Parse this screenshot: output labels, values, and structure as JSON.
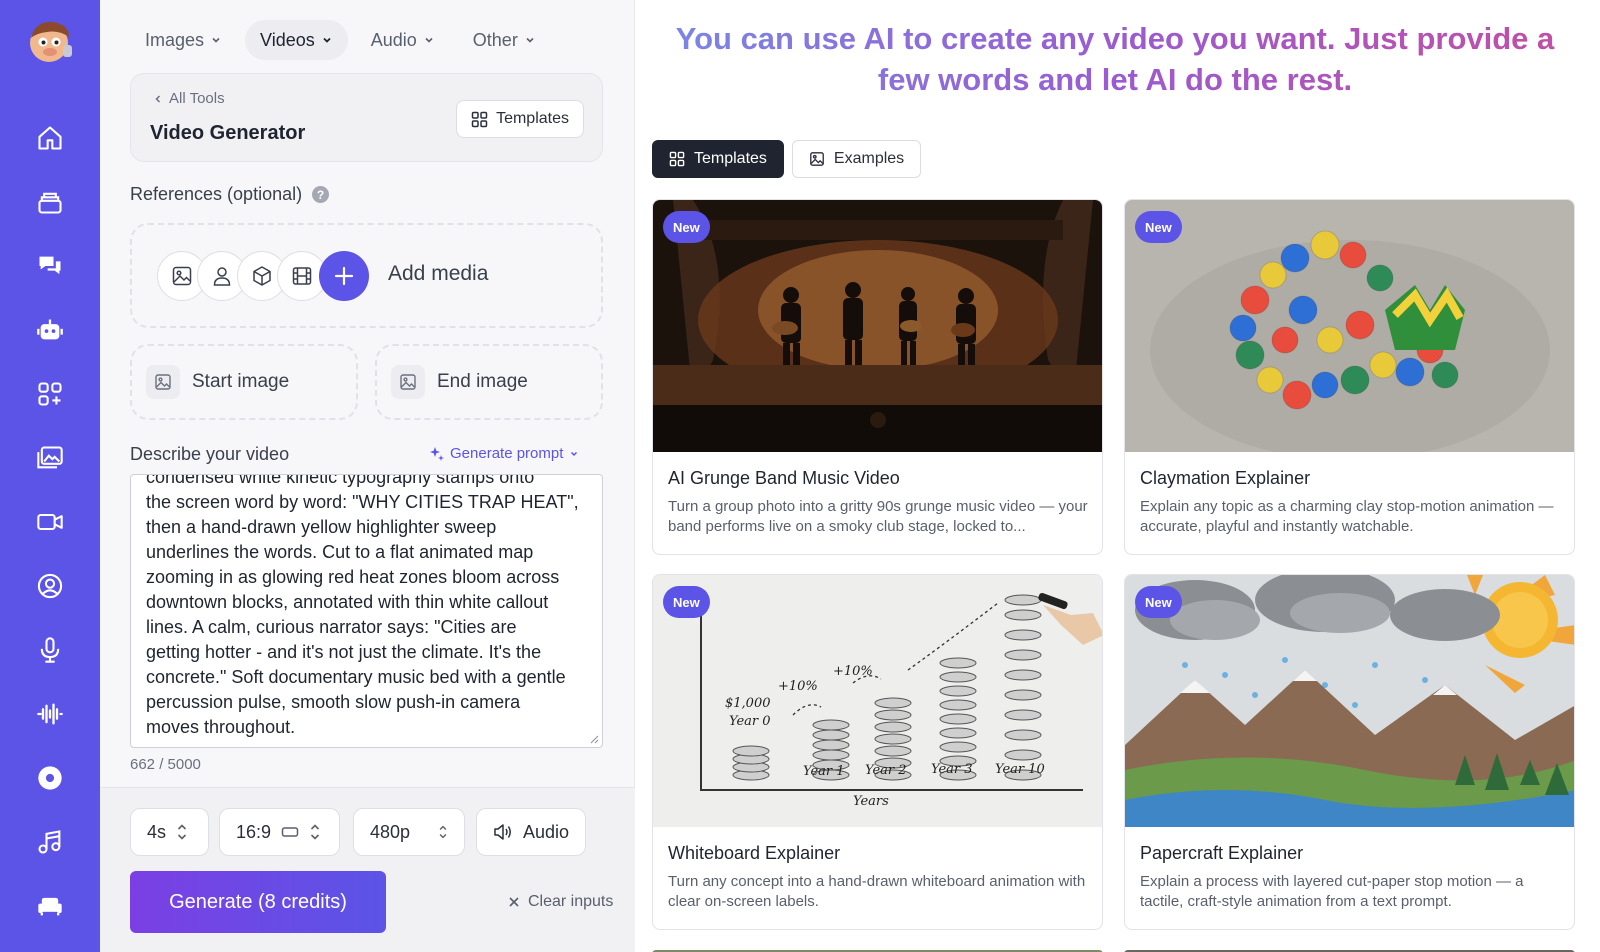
{
  "nav_tabs": [
    {
      "label": "Images"
    },
    {
      "label": "Videos"
    },
    {
      "label": "Audio"
    },
    {
      "label": "Other"
    }
  ],
  "tool": {
    "back_label": "All Tools",
    "title": "Video Generator",
    "templates_label": "Templates"
  },
  "references": {
    "label": "References (optional)",
    "help": "?",
    "add_media": "Add media"
  },
  "frames": {
    "start": "Start image",
    "end": "End image"
  },
  "prompt": {
    "label": "Describe your video",
    "generate_label": "Generate prompt",
    "text": "condensed white kinetic typography stamps onto\nthe screen word by word: \"WHY CITIES TRAP HEAT\",\nthen a hand-drawn yellow highlighter sweep\nunderlines the words. Cut to a flat animated map\nzooming in as glowing red heat zones bloom across\ndowntown blocks, annotated with thin white callout\nlines. A calm, curious narrator says: \"Cities are\ngetting hotter - and it's not just the climate. It's the\nconcrete.\" Soft documentary music bed with a gentle\npercussion pulse, smooth slow push-in camera\nmoves throughout.",
    "char_count": "662 / 5000"
  },
  "options": {
    "duration": "4s",
    "aspect": "16:9",
    "resolution": "480p",
    "audio": "Audio"
  },
  "actions": {
    "generate": "Generate (8 credits)",
    "clear": "Clear inputs"
  },
  "headline": "You can use AI to create any video you want. Just provide a few words and let AI do the rest.",
  "view_tabs": [
    {
      "label": "Templates"
    },
    {
      "label": "Examples"
    }
  ],
  "cards": [
    {
      "badge": "New",
      "title": "AI Grunge Band Music Video",
      "desc": "Turn a group photo into a gritty 90s grunge music video — your band performs live on a smoky club stage, locked to..."
    },
    {
      "badge": "New",
      "title": "Claymation Explainer",
      "desc": "Explain any topic as a charming clay stop-motion animation — accurate, playful and instantly watchable."
    },
    {
      "badge": "New",
      "title": "Whiteboard Explainer",
      "desc": "Turn any concept into a hand-drawn whiteboard animation with clear on-screen labels."
    },
    {
      "badge": "New",
      "title": "Papercraft Explainer",
      "desc": "Explain a process with layered cut-paper stop motion — a tactile, craft-style animation from a text prompt."
    }
  ],
  "whiteboard_labels": {
    "amount": "$1,000",
    "year0": "Year 0",
    "year1": "Year 1",
    "year2": "Year 2",
    "year3": "Year 3",
    "year10": "Year 10",
    "pct1": "+10%",
    "pct2": "+10%",
    "axis": "Years"
  },
  "colors": {
    "accent": "#5b54e6",
    "rail": "#5b54e6",
    "generate_start": "#7b3fe4",
    "dark_tab": "#1f2430"
  }
}
